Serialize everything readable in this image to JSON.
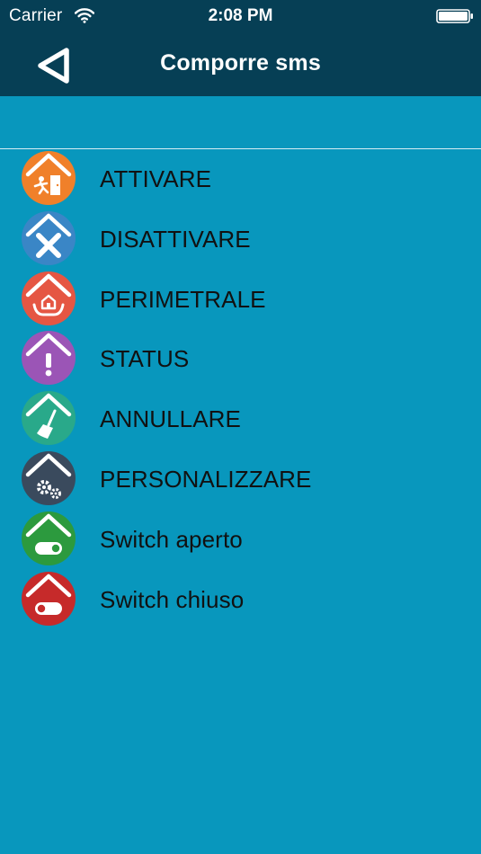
{
  "status_bar": {
    "carrier": "Carrier",
    "time": "2:08 PM"
  },
  "nav": {
    "title": "Comporre sms",
    "back_icon": "back-triangle-icon"
  },
  "theme": {
    "nav_background": "#063f55",
    "content_background": "#0897bd"
  },
  "commands": [
    {
      "label": "ATTIVARE",
      "icon": "activate-house-icon",
      "color": "#f0802a"
    },
    {
      "label": "DISATTIVARE",
      "icon": "deactivate-x-icon",
      "color": "#3a86c6"
    },
    {
      "label": "PERIMETRALE",
      "icon": "perimeter-house-icon",
      "color": "#e55643"
    },
    {
      "label": "STATUS",
      "icon": "status-exclamation-icon",
      "color": "#9b55b6"
    },
    {
      "label": "ANNULLARE",
      "icon": "cancel-broom-icon",
      "color": "#29a98a"
    },
    {
      "label": "PERSONALIZZARE",
      "icon": "customize-gears-icon",
      "color": "#3a4a5d"
    },
    {
      "label": "Switch aperto",
      "icon": "switch-open-icon",
      "color": "#2c9a3e"
    },
    {
      "label": "Switch chiuso",
      "icon": "switch-closed-icon",
      "color": "#c62a2a"
    }
  ]
}
